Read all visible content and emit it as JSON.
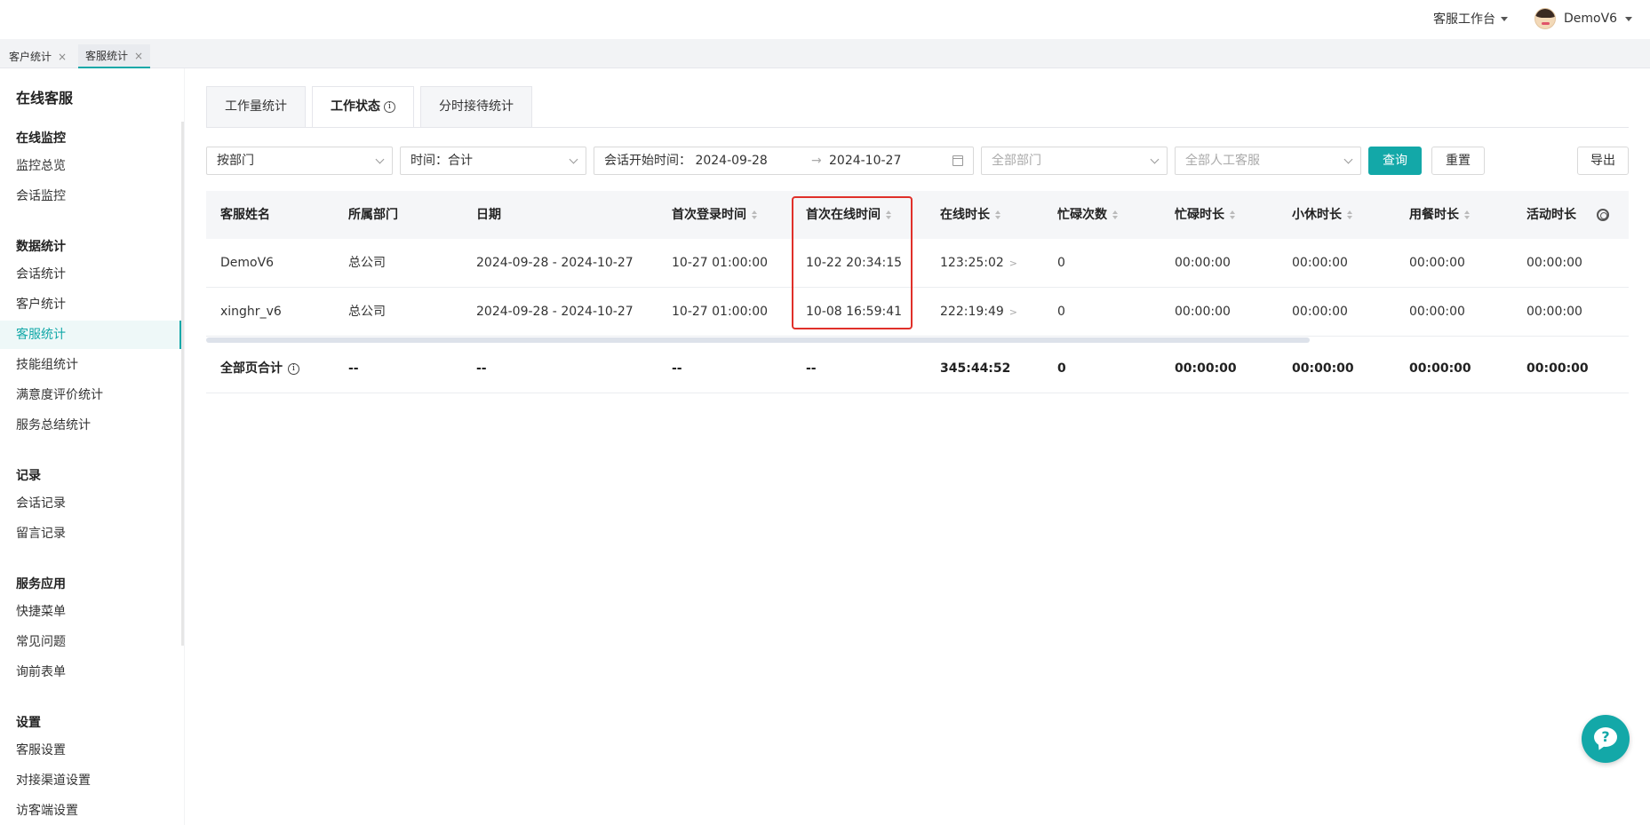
{
  "topbar": {
    "workbench_label": "客服工作台",
    "username": "DemoV6"
  },
  "page_tabs": [
    {
      "label": "客户统计",
      "close": "×"
    },
    {
      "label": "客服统计",
      "close": "×"
    }
  ],
  "sidebar": {
    "title": "在线客服",
    "groups": [
      {
        "label": "在线监控",
        "items": [
          "监控总览",
          "会话监控"
        ]
      },
      {
        "label": "数据统计",
        "items": [
          "会话统计",
          "客户统计",
          "客服统计",
          "技能组统计",
          "满意度评价统计",
          "服务总结统计"
        ]
      },
      {
        "label": "记录",
        "items": [
          "会话记录",
          "留言记录"
        ]
      },
      {
        "label": "服务应用",
        "items": [
          "快捷菜单",
          "常见问题",
          "询前表单"
        ]
      },
      {
        "label": "设置",
        "items": [
          "客服设置",
          "对接渠道设置",
          "访客端设置"
        ]
      }
    ],
    "active_item": "客服统计"
  },
  "content_tabs": [
    {
      "label": "工作量统计"
    },
    {
      "label": "工作状态",
      "info": "i"
    },
    {
      "label": "分时接待统计"
    }
  ],
  "filters": {
    "group_by": "按部门",
    "time": "时间：合计",
    "date_range_label": "会话开始时间：",
    "date_start": "2024-09-28",
    "date_sep": "→",
    "date_end": "2024-10-27",
    "department_placeholder": "全部部门",
    "agent_placeholder": "全部人工客服",
    "query_button": "查询",
    "reset_button": "重置",
    "export_button": "导出"
  },
  "table": {
    "columns": [
      "客服姓名",
      "所属部门",
      "日期",
      "首次登录时间",
      "首次在线时间",
      "在线时长",
      "忙碌次数",
      "忙碌时长",
      "小休时长",
      "用餐时长",
      "活动时长"
    ],
    "rows": [
      [
        "DemoV6",
        "总公司",
        "2024-09-28 - 2024-10-27",
        "10-27 01:00:00",
        "10-22 20:34:15",
        "123:25:02",
        "0",
        "00:00:00",
        "00:00:00",
        "00:00:00",
        "00:00:00"
      ],
      [
        "xinghr_v6",
        "总公司",
        "2024-09-28 - 2024-10-27",
        "10-27 01:00:00",
        "10-08 16:59:41",
        "222:19:49",
        "0",
        "00:00:00",
        "00:00:00",
        "00:00:00",
        "00:00:00"
      ]
    ],
    "summary": [
      "全部页合计",
      "--",
      "--",
      "--",
      "--",
      "345:44:52",
      "0",
      "00:00:00",
      "00:00:00",
      "00:00:00",
      "00:00:00"
    ],
    "more_glyph": ">",
    "summary_info": "i"
  },
  "help_button": {
    "glyph": "?"
  },
  "colors": {
    "accent": "#13a8a8",
    "highlight": "#e0302a"
  }
}
